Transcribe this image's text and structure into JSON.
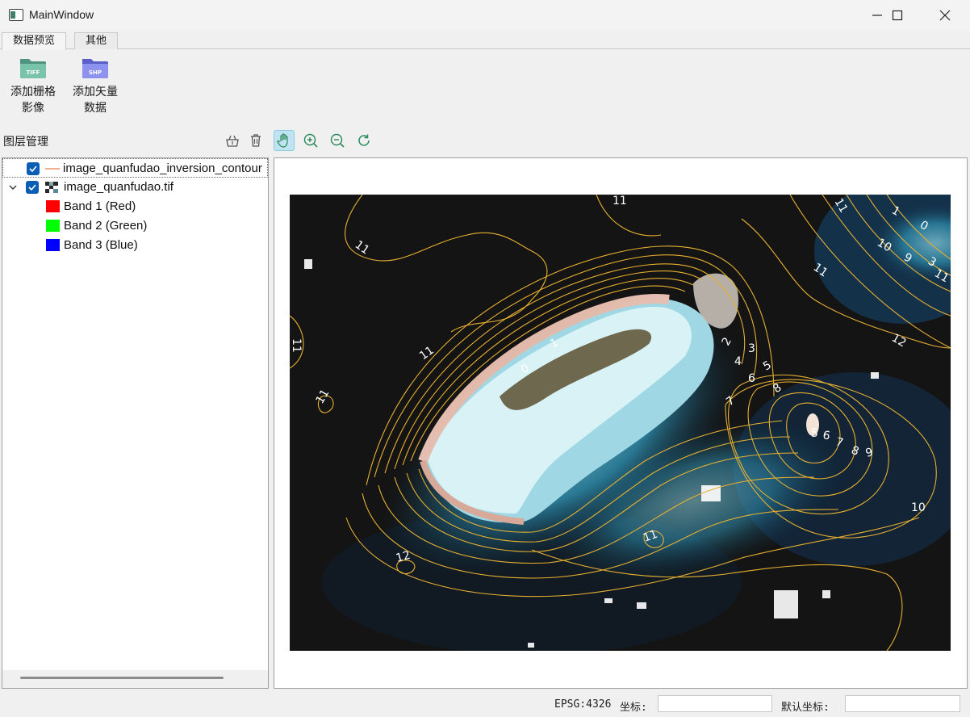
{
  "window": {
    "title": "MainWindow"
  },
  "tabs": [
    {
      "label": "数据预览",
      "active": true
    },
    {
      "label": "其他",
      "active": false
    }
  ],
  "ribbon": {
    "buttons": [
      {
        "label": "添加栅格\n影像",
        "icon": "folder-tiff-icon",
        "badge": "TIFF",
        "color": "#5aa08a"
      },
      {
        "label": "添加矢量\n数据",
        "icon": "folder-shp-icon",
        "badge": "SHP",
        "color": "#6a6fd8"
      }
    ]
  },
  "layer_manager": {
    "title": "图层管理",
    "tools": [
      "clear-icon",
      "delete-icon",
      "pan-hand-icon",
      "zoom-in-icon",
      "zoom-out-icon",
      "refresh-icon"
    ],
    "active_tool": "pan-hand-icon",
    "layers": [
      {
        "name": "image_quanfudao_inversion_contour",
        "checked": true,
        "type": "vector-line"
      },
      {
        "name": "image_quanfudao.tif",
        "checked": true,
        "type": "raster",
        "expanded": true,
        "bands": [
          {
            "name": "Band 1 (Red)",
            "color": "#ff0000"
          },
          {
            "name": "Band 2 (Green)",
            "color": "#00ff00"
          },
          {
            "name": "Band 3 (Blue)",
            "color": "#0000ff"
          }
        ]
      }
    ]
  },
  "map": {
    "contour_color": "#e8b030",
    "contour_labels": [
      "11",
      "11",
      "11",
      "11",
      "11",
      "11",
      "11",
      "12",
      "12",
      "10",
      "10",
      "9",
      "9",
      "8",
      "8",
      "7",
      "7",
      "6",
      "6",
      "5",
      "5",
      "4",
      "3",
      "3",
      "2",
      "1",
      "1",
      "0",
      "0",
      "11",
      "11"
    ]
  },
  "status": {
    "crs": "EPSG:4326",
    "coord_label": "坐标:",
    "coord_value": "",
    "default_coord_label": "默认坐标:",
    "default_coord_value": ""
  }
}
